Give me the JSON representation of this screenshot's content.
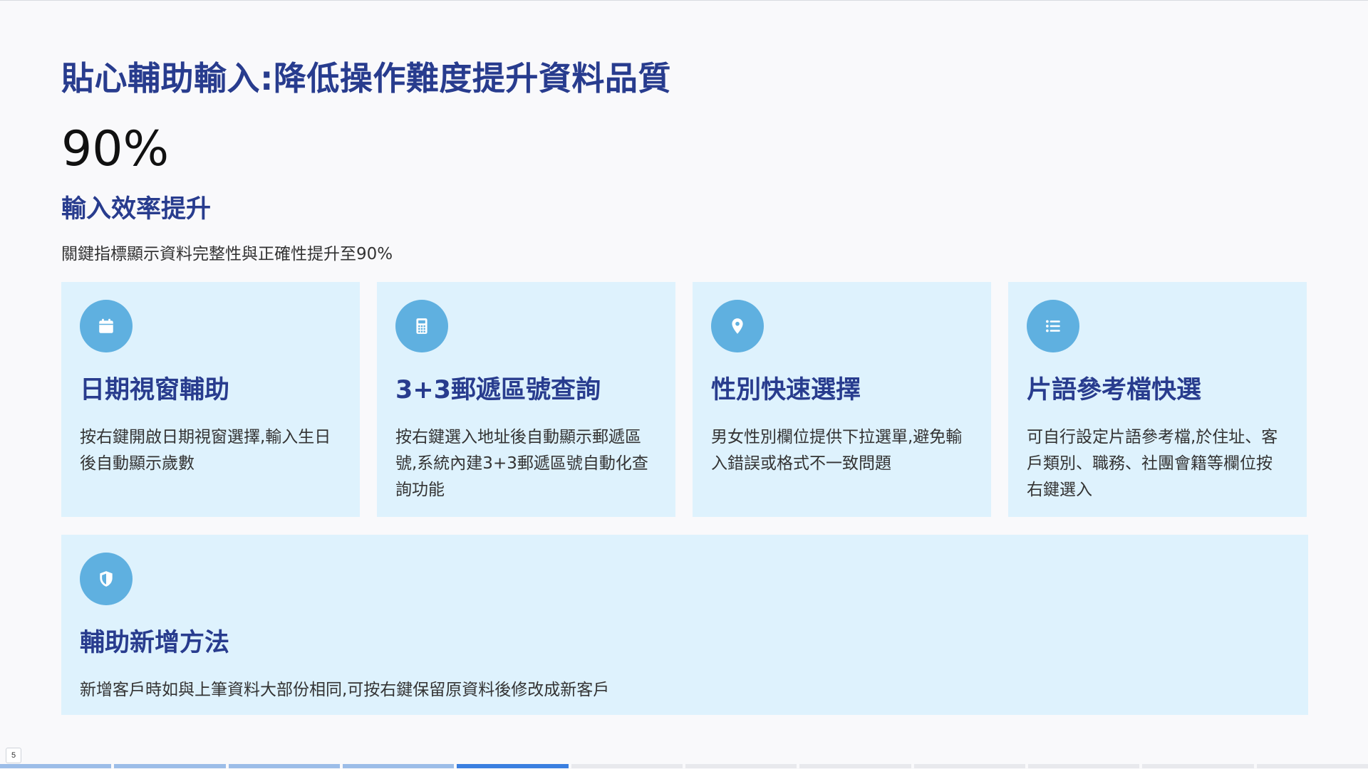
{
  "slide": {
    "title": "貼心輔助輸入:降低操作難度提升資料品質",
    "stat_value": "90%",
    "stat_label": "輸入效率提升",
    "stat_description": "關鍵指標顯示資料完整性與正確性提升至90%"
  },
  "cards": [
    {
      "icon": "calendar-icon",
      "title": "日期視窗輔助",
      "description": "按右鍵開啟日期視窗選擇,輸入生日後自動顯示歲數"
    },
    {
      "icon": "calculator-icon",
      "title": "3+3郵遞區號查詢",
      "description": "按右鍵選入地址後自動顯示郵遞區號,系統內建3+3郵遞區號自動化查詢功能"
    },
    {
      "icon": "map-pin-icon",
      "title": "性別快速選擇",
      "description": "男女性別欄位提供下拉選單,避免輸入錯誤或格式不一致問題"
    },
    {
      "icon": "list-icon",
      "title": "片語參考檔快選",
      "description": "可自行設定片語參考檔,於住址、客戶類別、職務、社團會籍等欄位按右鍵選入"
    },
    {
      "icon": "shield-icon",
      "title": "輔助新增方法",
      "description": "新增客戶時如與上筆資料大部份相同,可按右鍵保留原資料後修改成新客戶"
    }
  ],
  "footer": {
    "page_number": "5",
    "progress": {
      "total_segments": 12,
      "current_segment": 5
    }
  },
  "colors": {
    "title": "#283c8e",
    "card_background": "#def2fd",
    "icon_circle": "#5fb0e0",
    "progress_done": "#9cbde8",
    "progress_current": "#3a7fe0"
  }
}
